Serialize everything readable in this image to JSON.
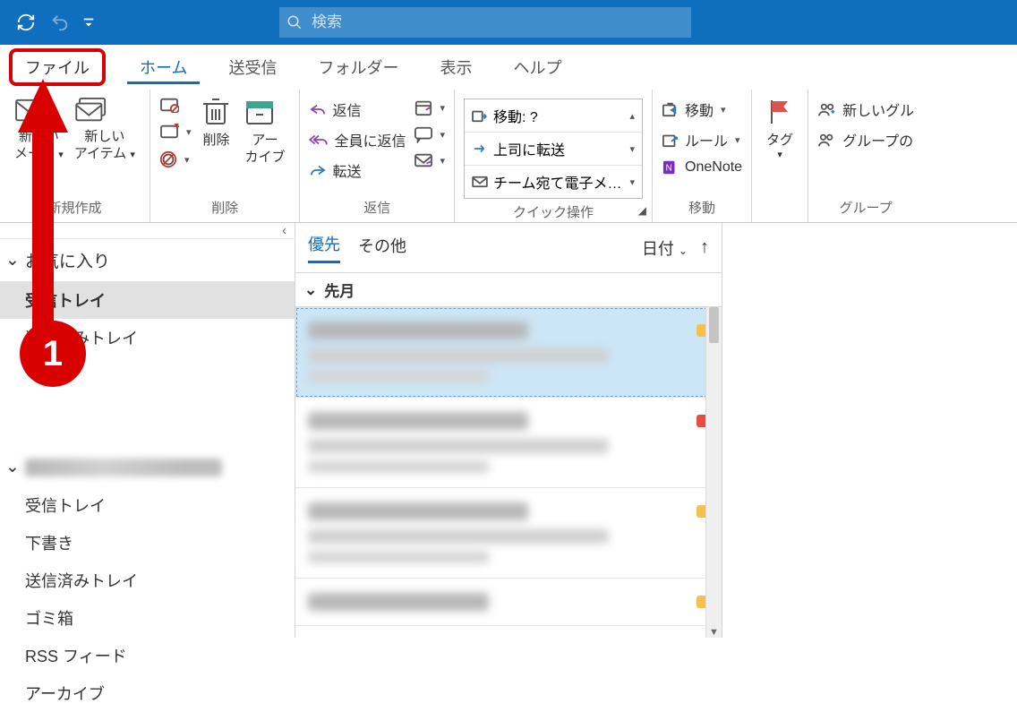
{
  "titlebar": {
    "search_placeholder": "検索"
  },
  "tabs": {
    "file": "ファイル",
    "home": "ホーム",
    "sendreceive": "送受信",
    "folder": "フォルダー",
    "view": "表示",
    "help": "ヘルプ"
  },
  "ribbon": {
    "new": {
      "mail": "新しい\nメール",
      "items": "新しい\nアイテム",
      "group_label": "新規作成"
    },
    "delete": {
      "delete": "削除",
      "archive": "アー\nカイブ",
      "group_label": "削除"
    },
    "respond": {
      "reply": "返信",
      "reply_all": "全員に返信",
      "forward": "転送",
      "group_label": "返信"
    },
    "quick": {
      "move_q": "移動: ?",
      "to_boss": "上司に転送",
      "team_mail": "チーム宛て電子メ…",
      "group_label": "クイック操作"
    },
    "move": {
      "move": "移動",
      "rules": "ルール",
      "onenote": "OneNote",
      "group_label": "移動"
    },
    "tags": {
      "label": "タグ"
    },
    "groups": {
      "new_group": "新しいグル",
      "browse_groups": "グループの",
      "group_label": "グループ"
    }
  },
  "nav": {
    "favorites": "お気に入り",
    "inbox": "受信トレイ",
    "sent": "送信済みトレイ",
    "trash": "ゴミ箱",
    "drafts": "下書き",
    "rss": "RSS フィード",
    "archive": "アーカイブ"
  },
  "list": {
    "focused": "優先",
    "other": "その他",
    "sort_by": "日付",
    "group_header": "先月"
  },
  "annotation": {
    "step": "1"
  }
}
